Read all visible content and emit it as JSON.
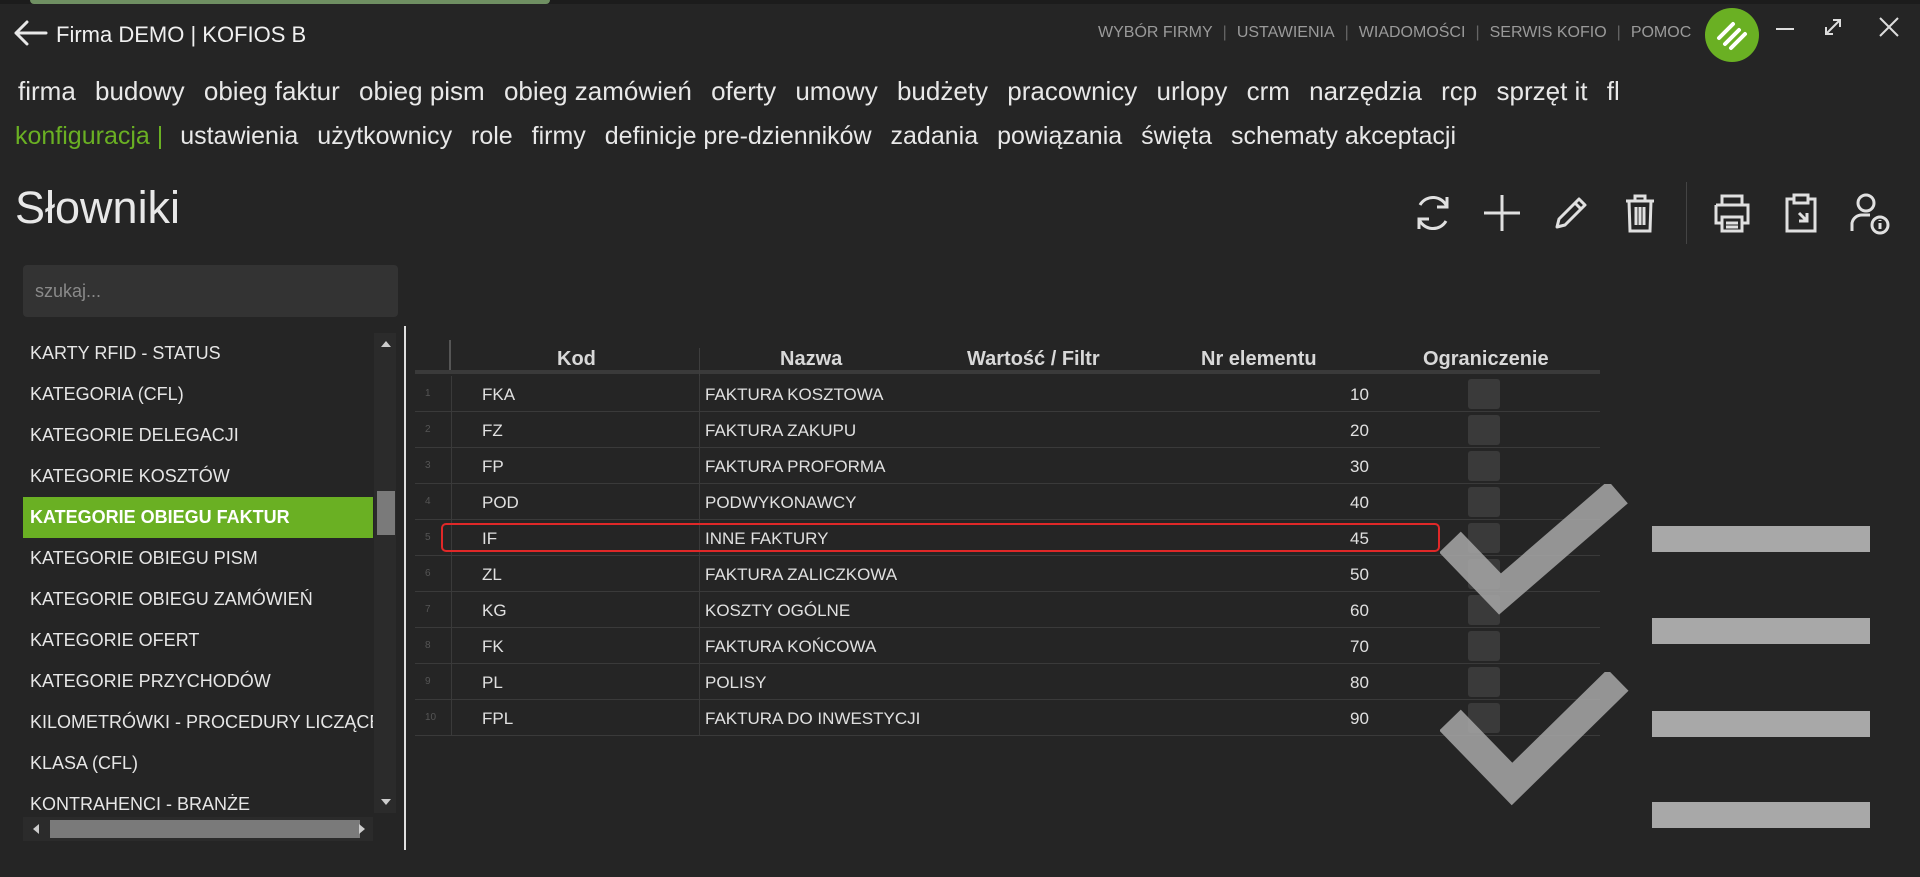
{
  "header": {
    "title": "Firma DEMO | KOFIOS B",
    "menu": [
      "WYBÓR FIRMY",
      "USTAWIENIA",
      "WIADOMOŚCI",
      "SERWIS KOFIO",
      "POMOC"
    ]
  },
  "nav_main": [
    "firma",
    "budowy",
    "obieg faktur",
    "obieg pism",
    "obieg zamówień",
    "oferty",
    "umowy",
    "budżety",
    "pracownicy",
    "urlopy",
    "crm",
    "narzędzia",
    "rcp",
    "sprzęt it",
    "flo"
  ],
  "nav_sub": {
    "active": "konfiguracja |",
    "items": [
      "ustawienia",
      "użytkownicy",
      "role",
      "firmy",
      "definicje pre-dzienników",
      "zadania",
      "powiązania",
      "święta",
      "schematy akceptacji"
    ]
  },
  "page": {
    "title": "Słowniki"
  },
  "search": {
    "placeholder": "szukaj..."
  },
  "dict_list": [
    "KARTY RFID - STATUS",
    "KATEGORIA (CFL)",
    "KATEGORIE DELEGACJI",
    "KATEGORIE KOSZTÓW",
    "KATEGORIE OBIEGU FAKTUR",
    "KATEGORIE OBIEGU PISM",
    "KATEGORIE OBIEGU ZAMÓWIEŃ",
    "KATEGORIE OFERT",
    "KATEGORIE PRZYCHODÓW",
    "KILOMETRÓWKI - PROCEDURY LICZĄCE",
    "KLASA (CFL)",
    "KONTRAHENCI - BRANŻE"
  ],
  "dict_selected_index": 4,
  "grid": {
    "columns": [
      "Kod",
      "Nazwa",
      "Wartość / Filtr",
      "Nr elementu",
      "Ograniczenie"
    ],
    "rows": [
      {
        "n": "1",
        "kod": "FKA",
        "nazwa": "FAKTURA KOSZTOWA",
        "nr": "10"
      },
      {
        "n": "2",
        "kod": "FZ",
        "nazwa": "FAKTURA ZAKUPU",
        "nr": "20"
      },
      {
        "n": "3",
        "kod": "FP",
        "nazwa": "FAKTURA PROFORMA",
        "nr": "30"
      },
      {
        "n": "4",
        "kod": "POD",
        "nazwa": "PODWYKONAWCY",
        "nr": "40"
      },
      {
        "n": "5",
        "kod": "IF",
        "nazwa": "INNE FAKTURY",
        "nr": "45"
      },
      {
        "n": "6",
        "kod": "ZL",
        "nazwa": "FAKTURA ZALICZKOWA",
        "nr": "50"
      },
      {
        "n": "7",
        "kod": "KG",
        "nazwa": "KOSZTY OGÓLNE",
        "nr": "60"
      },
      {
        "n": "8",
        "kod": "FK",
        "nazwa": "FAKTURA KOŃCOWA",
        "nr": "70"
      },
      {
        "n": "9",
        "kod": "PL",
        "nazwa": "POLISY",
        "nr": "80"
      },
      {
        "n": "10",
        "kod": "FPL",
        "nazwa": "FAKTURA DO INWESTYCJI",
        "nr": "90"
      }
    ]
  },
  "colors": {
    "accent": "#6ab023",
    "highlight": "#e02828",
    "background": "#252525"
  }
}
